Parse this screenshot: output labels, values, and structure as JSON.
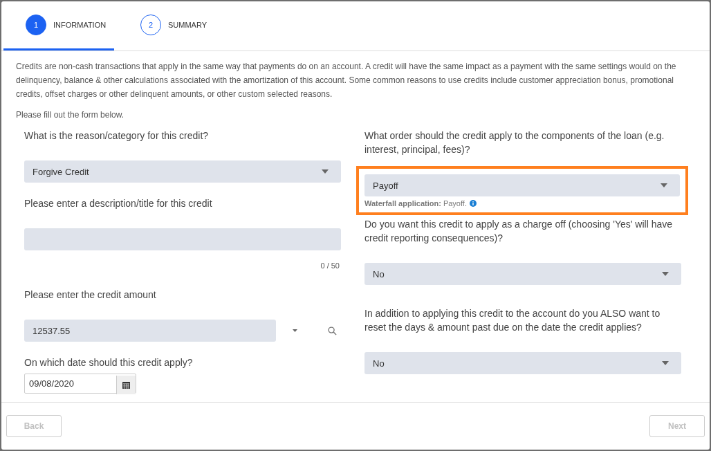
{
  "tabs": [
    {
      "number": "1",
      "label": "INFORMATION",
      "selected": true
    },
    {
      "number": "2",
      "label": "SUMMARY",
      "selected": false
    }
  ],
  "intro": "Credits are non-cash transactions that apply in the same way that payments do on an account. A credit will have the same impact as a payment with the same settings would on the delinquency, balance & other calculations associated with the amortization of this account. Some common reasons to use credits include customer appreciation bonus, promotional credits, offset charges or other delinquent amounts, or other custom selected reasons.",
  "instruction": "Please fill out the form below.",
  "left_fields": [
    {
      "kind": "select",
      "label": "What is the reason/category for this credit?",
      "value": "Forgive Credit"
    },
    {
      "kind": "text",
      "label": "Please enter a description/title for this credit",
      "counter": "0 / 50"
    },
    {
      "kind": "amount",
      "label": "Please enter the credit amount",
      "value": "12537.55"
    },
    {
      "kind": "date",
      "label": "On which date should this credit apply?",
      "value": "09/08/2020"
    }
  ],
  "right_fields": [
    {
      "kind": "select",
      "label": "What order should the credit apply to the components of the loan (e.g. interest, principal, fees)?",
      "value": "Payoff",
      "highlighted": true,
      "hint_label": "Waterfall application:",
      "hint_value": "Payoff."
    },
    {
      "kind": "select",
      "label": "Do you want this credit to apply as a charge off (choosing 'Yes' will have credit reporting consequences)?",
      "value": "No",
      "highlighted": false
    },
    {
      "kind": "select",
      "label": "In addition to applying this credit to the account do you ALSO want to reset the days & amount past due on the date the credit applies?",
      "value": "No",
      "highlighted": false
    }
  ],
  "buttons": [
    {
      "label": "Back",
      "disabled": true
    },
    {
      "label": "Next",
      "disabled": true
    }
  ]
}
